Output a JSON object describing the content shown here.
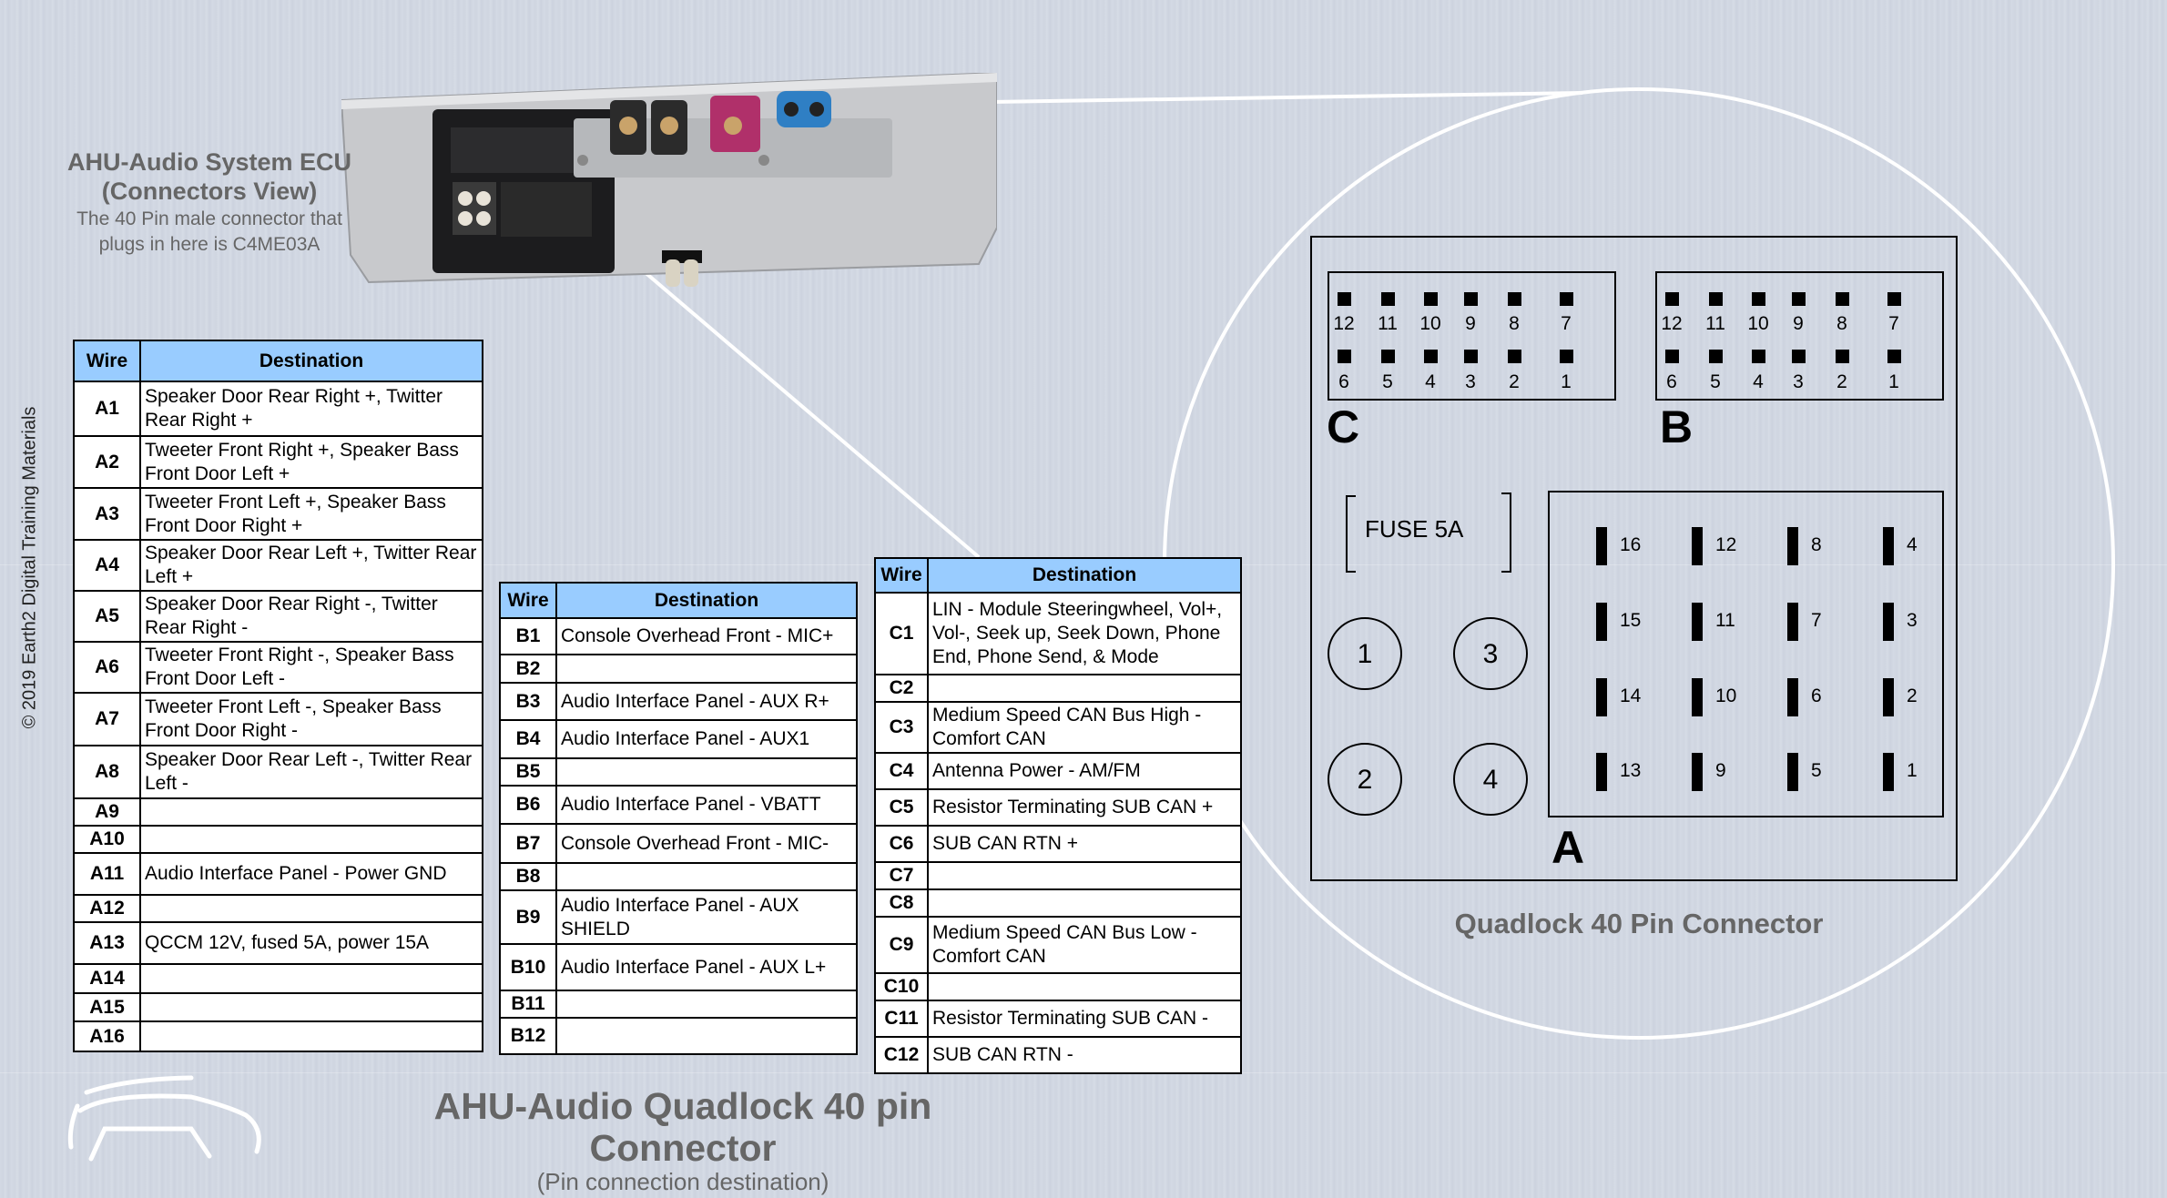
{
  "ecu_caption": {
    "title_line1": "AHU-Audio System ECU",
    "title_line2": "(Connectors View)",
    "note_line1": "The 40 Pin male connector that",
    "note_line2": "plugs in here is C4ME03A"
  },
  "copyright": "© 2019 Earth2 Digital Training Materials",
  "table_headers": {
    "wire": "Wire",
    "destination": "Destination"
  },
  "table_a": [
    {
      "wire": "A1",
      "dest": "Speaker Door Rear Right +, Twitter Rear Right +"
    },
    {
      "wire": "A2",
      "dest": "Tweeter Front Right +, Speaker Bass Front Door Left +"
    },
    {
      "wire": "A3",
      "dest": "Tweeter Front Left +, Speaker Bass Front Door Right +"
    },
    {
      "wire": "A4",
      "dest": "Speaker Door Rear Left +, Twitter Rear Left +"
    },
    {
      "wire": "A5",
      "dest": "Speaker Door Rear Right -, Twitter Rear Right -"
    },
    {
      "wire": "A6",
      "dest": "Tweeter Front Right -, Speaker Bass Front Door Left -"
    },
    {
      "wire": "A7",
      "dest": "Tweeter Front Left -, Speaker Bass Front Door Right -"
    },
    {
      "wire": "A8",
      "dest": "Speaker Door Rear Left -, Twitter Rear Left -"
    },
    {
      "wire": "A9",
      "dest": ""
    },
    {
      "wire": "A10",
      "dest": ""
    },
    {
      "wire": "A11",
      "dest": "Audio Interface Panel - Power GND"
    },
    {
      "wire": "A12",
      "dest": ""
    },
    {
      "wire": "A13",
      "dest": "QCCM 12V, fused 5A, power 15A"
    },
    {
      "wire": "A14",
      "dest": ""
    },
    {
      "wire": "A15",
      "dest": ""
    },
    {
      "wire": "A16",
      "dest": ""
    }
  ],
  "table_b": [
    {
      "wire": "B1",
      "dest": "Console Overhead Front - MIC+"
    },
    {
      "wire": "B2",
      "dest": ""
    },
    {
      "wire": "B3",
      "dest": "Audio Interface Panel - AUX R+"
    },
    {
      "wire": "B4",
      "dest": "Audio Interface Panel - AUX1"
    },
    {
      "wire": "B5",
      "dest": ""
    },
    {
      "wire": "B6",
      "dest": "Audio Interface Panel - VBATT"
    },
    {
      "wire": "B7",
      "dest": "Console Overhead Front - MIC-"
    },
    {
      "wire": "B8",
      "dest": ""
    },
    {
      "wire": "B9",
      "dest": "Audio Interface Panel - AUX SHIELD"
    },
    {
      "wire": "B10",
      "dest": "Audio Interface Panel - AUX L+"
    },
    {
      "wire": "B11",
      "dest": ""
    },
    {
      "wire": "B12",
      "dest": ""
    }
  ],
  "table_c": [
    {
      "wire": "C1",
      "dest": "LIN - Module Steeringwheel, Vol+, Vol-, Seek up, Seek Down, Phone End, Phone Send, & Mode"
    },
    {
      "wire": "C2",
      "dest": ""
    },
    {
      "wire": "C3",
      "dest": "Medium Speed CAN Bus High - Comfort CAN"
    },
    {
      "wire": "C4",
      "dest": "Antenna Power - AM/FM"
    },
    {
      "wire": "C5",
      "dest": "Resistor Terminating SUB CAN +"
    },
    {
      "wire": "C6",
      "dest": "SUB CAN RTN +"
    },
    {
      "wire": "C7",
      "dest": ""
    },
    {
      "wire": "C8",
      "dest": ""
    },
    {
      "wire": "C9",
      "dest": "Medium Speed CAN Bus Low - Comfort CAN"
    },
    {
      "wire": "C10",
      "dest": ""
    },
    {
      "wire": "C11",
      "dest": "Resistor Terminating SUB CAN -"
    },
    {
      "wire": "C12",
      "dest": "SUB CAN RTN -"
    }
  ],
  "connector": {
    "title": "Quadlock 40 Pin Connector",
    "block_c_label": "C",
    "block_b_label": "B",
    "block_a_label": "A",
    "small_block_top_row": [
      "12",
      "11",
      "10",
      "9",
      "8",
      "7"
    ],
    "small_block_bottom_row": [
      "6",
      "5",
      "4",
      "3",
      "2",
      "1"
    ],
    "fuse_label": "FUSE 5A",
    "round_pins": [
      "1",
      "3",
      "2",
      "4"
    ],
    "block_a_columns": [
      [
        "16",
        "15",
        "14",
        "13"
      ],
      [
        "12",
        "11",
        "10",
        "9"
      ],
      [
        "8",
        "7",
        "6",
        "5"
      ],
      [
        "4",
        "3",
        "2",
        "1"
      ]
    ]
  },
  "footer": {
    "title": "AHU-Audio Quadlock 40 pin Connector",
    "subtitle": "(Pin connection destination)"
  },
  "colors": {
    "table_header": "#99ccff",
    "caption_gray": "#666666",
    "connector_pink": "#b0306a",
    "connector_blue": "#2f7fc4"
  }
}
